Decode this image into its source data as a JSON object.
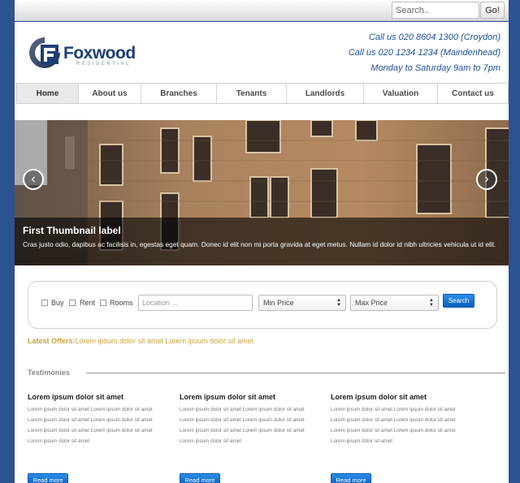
{
  "search": {
    "placeholder": "Search..",
    "go_label": "Go!"
  },
  "brand": {
    "name": "Foxwood",
    "tagline": "RESIDENTIAL",
    "color": "#1d3f75"
  },
  "contact": {
    "line1": "Call us 020 8604 1300 (Croydon)",
    "line2": "Call us 020 1234 1234 (Maindenhead)",
    "line3": "Monday to Saturday 9am to 7pm"
  },
  "nav": {
    "items": [
      {
        "label": "Home",
        "active": true
      },
      {
        "label": "About us"
      },
      {
        "label": "Branches"
      },
      {
        "label": "Tenants"
      },
      {
        "label": "Landlords"
      },
      {
        "label": "Valuation"
      },
      {
        "label": "Contact us"
      }
    ]
  },
  "carousel": {
    "title": "First Thumbnail label",
    "text": "Cras justo odio, dapibus ac facilisis in, egestas eget quam. Donec id elit non mi porta gravida at eget metus. Nullam id dolor id nibh ultricies vehicula ut id elit.",
    "prev_icon": "chevron-left-icon",
    "next_icon": "chevron-right-icon"
  },
  "property_search": {
    "buy_label": "Buy",
    "rent_label": "Rent",
    "rooms_label": "Rooms",
    "location_placeholder": "Location ...",
    "min_price": "Min Price",
    "max_price": "Max Price",
    "search_label": "Search"
  },
  "offers": {
    "label": "Latest Offers:",
    "text": "Lorem ipsum dolor sit amet Lorem ipsum dolor sit amet"
  },
  "testimonies": {
    "title": "Testimonies",
    "items": [
      {
        "heading": "Lorem ipsum dolor sit amet",
        "lines": [
          "Lorem ipsum dolor sit amet Lorem ipsum dolor sit amet",
          "Lorem ipsum dolor sit amet Lorem ipsum dolor sit amet",
          "Lorem ipsum dolor sit amet Lorem ipsum dolor sit amet",
          "Lorem ipsum dolor sit amet"
        ],
        "button": "Read more"
      },
      {
        "heading": "Lorem ipsum dolor sit amet",
        "lines": [
          "Lorem ipsum dolor sit amet Lorem ipsum dolor sit amet",
          "Lorem ipsum dolor sit amet Lorem ipsum dolor sit amet",
          "Lorem ipsum dolor sit amet Lorem ipsum dolor sit amet",
          "Lorem ipsum dolor sit amet"
        ],
        "button": "Read more"
      },
      {
        "heading": "Lorem ipsum dolor sit amet",
        "lines": [
          "Lorem ipsum dolor sit amet Lorem ipsum dolor sit amet",
          "Lorem ipsum dolor sit amet Lorem ipsum dolor sit amet",
          "Lorem ipsum dolor sit amet Lorem ipsum dolor sit amet",
          "Lorem ipsum dolor sit amet"
        ],
        "button": "Read more"
      }
    ]
  }
}
